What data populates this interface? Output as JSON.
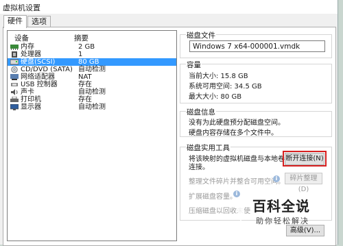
{
  "window": {
    "title": "虚拟机设置"
  },
  "tabs": [
    {
      "label": "硬件"
    },
    {
      "label": "选项"
    }
  ],
  "device_list": {
    "col_device": "设备",
    "col_summary": "摘要",
    "rows": [
      {
        "name": "内存",
        "value": "2 GB",
        "icon": "memory-icon"
      },
      {
        "name": "处理器",
        "value": "1",
        "icon": "cpu-icon"
      },
      {
        "name": "硬盘(SCSI)",
        "value": "80 GB",
        "icon": "harddisk-icon",
        "selected": true
      },
      {
        "name": "CD/DVD (SATA)",
        "value": "自动检测",
        "icon": "cdrom-icon"
      },
      {
        "name": "网络适配器",
        "value": "NAT",
        "icon": "network-icon"
      },
      {
        "name": "USB 控制器",
        "value": "存在",
        "icon": "usb-icon"
      },
      {
        "name": "声卡",
        "value": "自动检测",
        "icon": "sound-icon"
      },
      {
        "name": "打印机",
        "value": "存在",
        "icon": "printer-icon"
      },
      {
        "name": "显示器",
        "value": "自动检测",
        "icon": "display-icon"
      }
    ]
  },
  "disk_file": {
    "title": "磁盘文件",
    "value": "Windows 7 x64-000001.vmdk"
  },
  "capacity": {
    "title": "容量",
    "current": "当前大小: 15.8 GB",
    "free": "系统可用空间: 34.5 GB",
    "max": "最大大小: 80 GB"
  },
  "disk_info": {
    "title": "磁盘信息",
    "line1": "没有为此硬盘预分配磁盘空间。",
    "line2": "硬盘内容存储在多个文件中。"
  },
  "disk_tools": {
    "title": "磁盘实用工具",
    "map_text_1": "将该映射的虚拟机磁盘与本地卷断开",
    "map_text_2": "连接。",
    "disconnect_button": "断开连接(N)",
    "defrag_text": "整理文件碎片并整合可用空间。",
    "defrag_button": "碎片整理(D)",
    "expand_text": "扩展磁盘容量。",
    "compact_text": "压缩磁盘以回收未使",
    "advanced_button": "高级(V)..."
  },
  "watermark": {
    "title": "百科全说",
    "subtitle": "助你轻松解决"
  }
}
